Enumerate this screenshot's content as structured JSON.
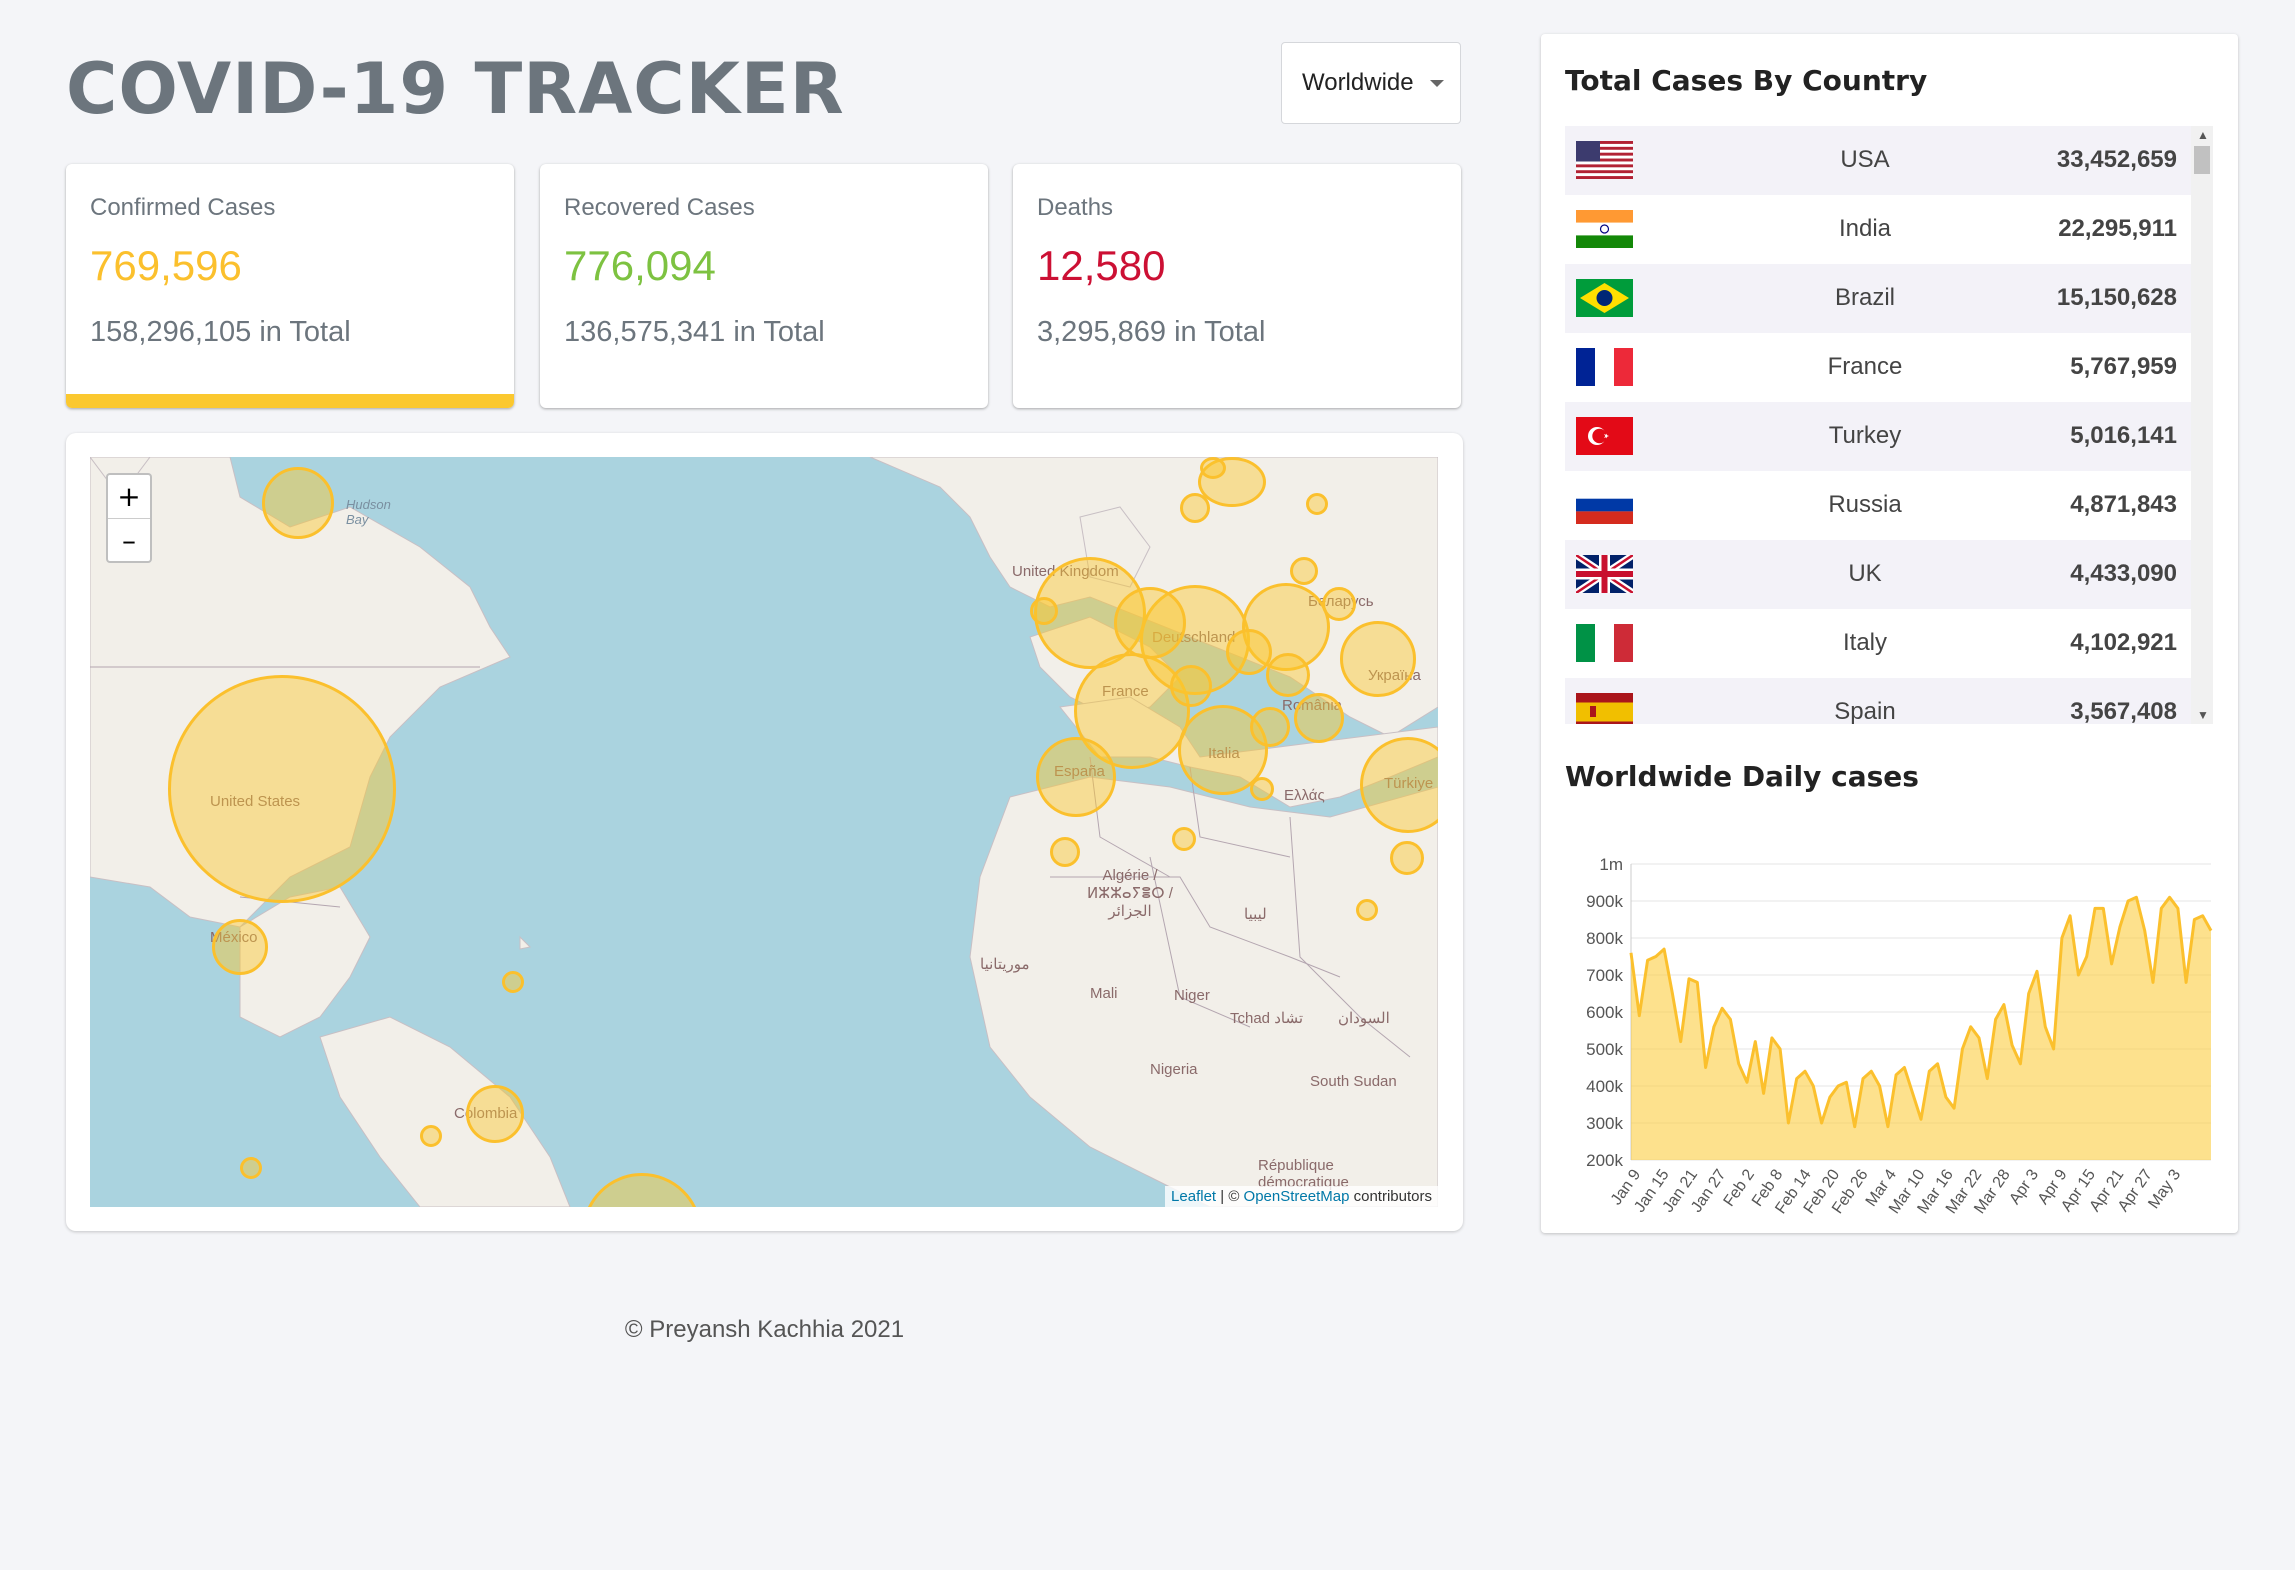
{
  "app": {
    "title": "COVID-19 TRACKER"
  },
  "region_select": {
    "value": "Worldwide"
  },
  "cards": [
    {
      "label": "Confirmed Cases",
      "today": "769,596",
      "total": "158,296,105 in Total",
      "color": "#fbc02d",
      "active": true
    },
    {
      "label": "Recovered Cases",
      "today": "776,094",
      "total": "136,575,341 in Total",
      "color": "#7dc241",
      "active": false
    },
    {
      "label": "Deaths",
      "today": "12,580",
      "total": "3,295,869 in Total",
      "color": "#cc1034",
      "active": false
    }
  ],
  "map": {
    "zoom_in": "+",
    "zoom_out": "–",
    "attribution": {
      "leaflet": "Leaflet",
      "sep": " | © ",
      "osm": "OpenStreetMap",
      "tail": " contributors"
    },
    "labels": [
      "United States",
      "México",
      "United Kingdom",
      "Deutschland",
      "France",
      "España",
      "Italia",
      "România",
      "Україна",
      "Türkiye",
      "Algérie / ⵍⵣⵣⴰⵢⴻⵔ / الجزائر",
      "ليبيا",
      "موريتانيا",
      "Mali",
      "Niger",
      "Tchad تشاد",
      "السودان",
      "Nigeria",
      "South Sudan",
      "Colombia",
      "Беларусь",
      "Ελλάς",
      "République démocratique",
      "Hudson Bay"
    ],
    "bubble_color": "#fbc02d"
  },
  "sidebar": {
    "table_title": "Total Cases By Country",
    "countries": [
      {
        "name": "USA",
        "cases": "33,452,659",
        "flag": "us-flag"
      },
      {
        "name": "India",
        "cases": "22,295,911",
        "flag": "india-flag"
      },
      {
        "name": "Brazil",
        "cases": "15,150,628",
        "flag": "brazil-flag"
      },
      {
        "name": "France",
        "cases": "5,767,959",
        "flag": "france-flag"
      },
      {
        "name": "Turkey",
        "cases": "5,016,141",
        "flag": "turkey-flag"
      },
      {
        "name": "Russia",
        "cases": "4,871,843",
        "flag": "russia-flag"
      },
      {
        "name": "UK",
        "cases": "4,433,090",
        "flag": "uk-flag"
      },
      {
        "name": "Italy",
        "cases": "4,102,921",
        "flag": "italy-flag"
      },
      {
        "name": "Spain",
        "cases": "3,567,408",
        "flag": "spain-flag"
      }
    ],
    "chart_title": "Worldwide Daily cases"
  },
  "chart_data": {
    "type": "area",
    "title": "Worldwide Daily cases",
    "xlabel": "",
    "ylabel": "",
    "ylim": [
      200000,
      1000000
    ],
    "y_ticks": [
      "200k",
      "300k",
      "400k",
      "500k",
      "600k",
      "700k",
      "800k",
      "900k",
      "1m"
    ],
    "x_ticks": [
      "Jan 9",
      "Jan 15",
      "Jan 21",
      "Jan 27",
      "Feb 2",
      "Feb 8",
      "Feb 14",
      "Feb 20",
      "Feb 26",
      "Mar 4",
      "Mar 10",
      "Mar 16",
      "Mar 22",
      "Mar 28",
      "Apr 3",
      "Apr 9",
      "Apr 15",
      "Apr 21",
      "Apr 27",
      "May 3"
    ],
    "color": "#fbc02d",
    "fill": "rgba(251,200,47,0.55)",
    "grid": true,
    "values": [
      760000,
      590000,
      740000,
      750000,
      770000,
      650000,
      520000,
      690000,
      680000,
      450000,
      560000,
      610000,
      580000,
      460000,
      410000,
      520000,
      380000,
      530000,
      500000,
      300000,
      420000,
      440000,
      400000,
      300000,
      370000,
      400000,
      410000,
      290000,
      420000,
      440000,
      400000,
      290000,
      430000,
      450000,
      380000,
      310000,
      440000,
      460000,
      370000,
      340000,
      500000,
      560000,
      530000,
      420000,
      580000,
      620000,
      510000,
      460000,
      650000,
      710000,
      560000,
      500000,
      800000,
      860000,
      700000,
      750000,
      880000,
      880000,
      730000,
      830000,
      900000,
      910000,
      820000,
      680000,
      880000,
      910000,
      880000,
      680000,
      850000,
      860000,
      820000
    ]
  },
  "footer": {
    "text": "© Preyansh Kachhia 2021"
  }
}
